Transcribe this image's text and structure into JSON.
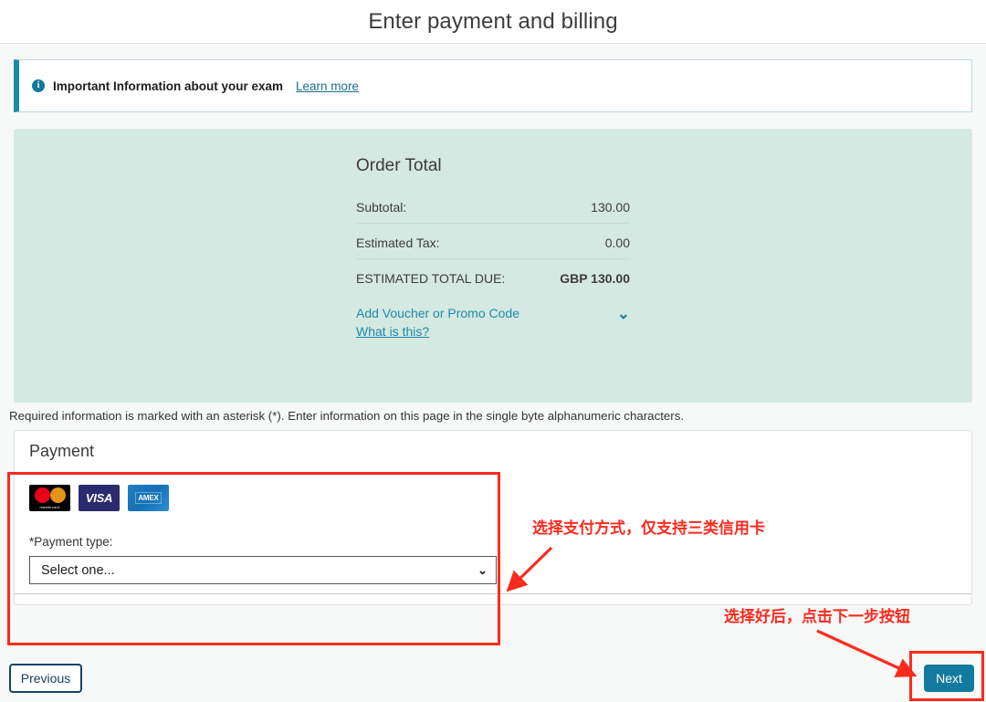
{
  "page": {
    "title": "Enter payment and billing"
  },
  "banner": {
    "icon": "info-circle-icon",
    "text": "Important Information about your exam",
    "link_label": "Learn more"
  },
  "order_total": {
    "heading": "Order Total",
    "rows": [
      {
        "label": "Subtotal:",
        "value": "130.00"
      },
      {
        "label": "Estimated Tax:",
        "value": "0.00"
      }
    ],
    "total_label": "ESTIMATED TOTAL DUE:",
    "total_value": "GBP 130.00",
    "voucher_link": "Add Voucher or Promo Code",
    "voucher_help": "What is this?",
    "chevron": "chevron-down-icon",
    "background_color": "#d4e9e1"
  },
  "required_note": "Required information is marked with an asterisk (*). Enter information on this page in the single byte alphanumeric characters.",
  "payment": {
    "heading": "Payment",
    "card_logos": [
      {
        "name": "mastercard-logo",
        "label": "mastercard"
      },
      {
        "name": "visa-logo",
        "label": "VISA"
      },
      {
        "name": "amex-logo",
        "label": "AMEX"
      }
    ],
    "payment_type_label": "*Payment type:",
    "payment_type_value": "Select one...",
    "payment_type_options": [
      "Select one..."
    ]
  },
  "footer": {
    "previous_label": "Previous",
    "next_label": "Next",
    "next_color": "#127a9e",
    "previous_border_color": "#15426b"
  },
  "annotations": {
    "color": "#fb2b1e",
    "note_payment": "选择支付方式，仅支持三类信用卡",
    "note_next": "选择好后，点击下一步按钮"
  }
}
